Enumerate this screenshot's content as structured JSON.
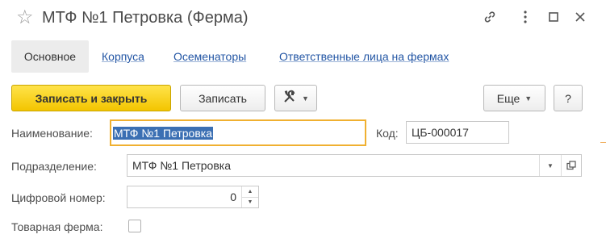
{
  "window": {
    "title": "МТФ №1 Петровка (Ферма)",
    "favorite_icon": "star-icon",
    "link_icon": "link-icon",
    "menu_icon": "more-vertical-icon",
    "maximize_icon": "maximize-icon",
    "close_icon": "close-icon"
  },
  "tabs": [
    {
      "label": "Основное",
      "active": true
    },
    {
      "label": "Корпуса"
    },
    {
      "label": "Осеменаторы"
    },
    {
      "label": "Ответственные лица на фермах"
    }
  ],
  "toolbar": {
    "save_close_label": "Записать и закрыть",
    "save_label": "Записать",
    "tools_icon": "tools-icon",
    "more_label": "Еще",
    "help_label": "?"
  },
  "form": {
    "name_label": "Наименование:",
    "name_value": "МТФ №1 Петровка",
    "code_label": "Код:",
    "code_value": "ЦБ-000017",
    "division_label": "Подразделение:",
    "division_value": "МТФ №1 Петровка",
    "digital_label": "Цифровой номер:",
    "digital_value": "0",
    "commodity_label": "Товарная ферма:",
    "commodity_checked": false
  },
  "colors": {
    "accent_yellow": "#f3c500",
    "link_blue": "#2255a4",
    "focus_border": "#f0b030",
    "selection": "#3b6fb3"
  }
}
